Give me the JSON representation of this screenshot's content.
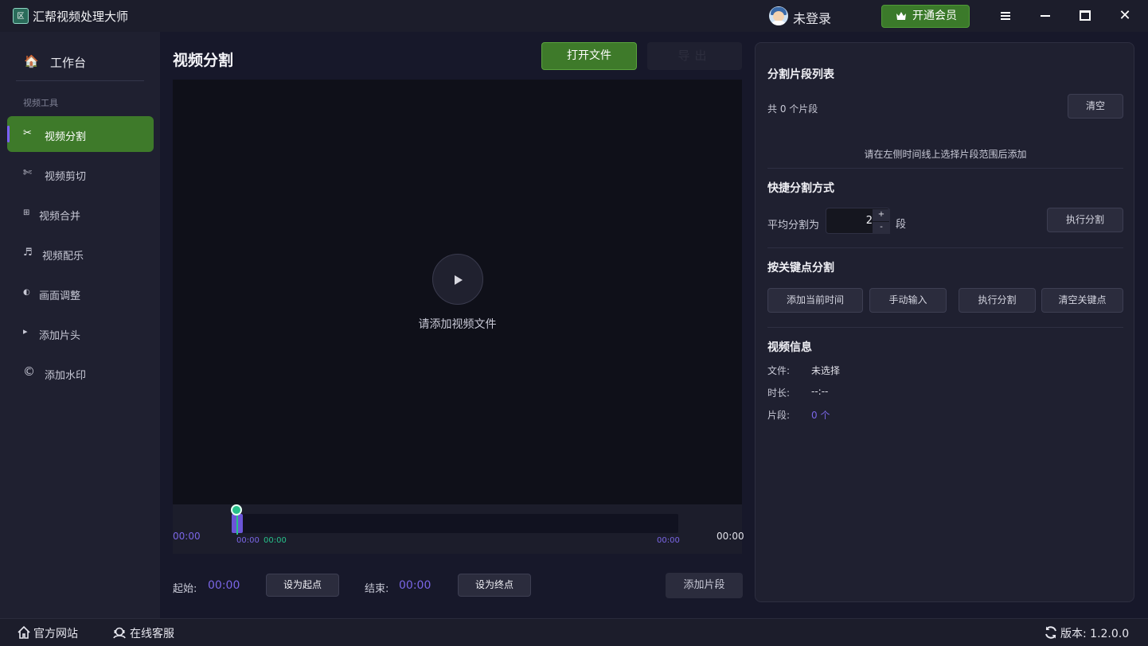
{
  "app": {
    "title": "汇帮视频处理大师",
    "logo_text": "区"
  },
  "titlebar": {
    "user_label": "未登录",
    "vip_button": "开通会员"
  },
  "sidebar": {
    "home": {
      "label": "工作台",
      "icon": "🏠"
    },
    "section_label": "视频工具",
    "items": [
      {
        "label": "视频分割",
        "icon": "✂"
      },
      {
        "label": "视频剪切",
        "icon": "✄"
      },
      {
        "label": "视频合并",
        "icon": "⊞"
      },
      {
        "label": "视频配乐",
        "icon": "♬"
      },
      {
        "label": "画面调整",
        "icon": "◐"
      },
      {
        "label": "添加片头",
        "icon": "▸"
      },
      {
        "label": "添加水印",
        "icon": "©"
      }
    ]
  },
  "main": {
    "title": "视频分割",
    "open_button": "打开文件",
    "export_button": "导出",
    "player_hint": "请添加视频文件",
    "timeline": {
      "time_left": "00:00",
      "time_right": "00:00",
      "marker_start": "00:00",
      "marker_current": "00:00",
      "marker_end": "00:00",
      "position_fraction": 0
    },
    "controls": {
      "start_label": "起始:",
      "start_value": "00:00",
      "set_start_button": "设为起点",
      "end_label": "结束:",
      "end_value": "00:00",
      "set_end_button": "设为终点",
      "add_segment_button": "添加片段"
    }
  },
  "panel": {
    "segments_title": "分割片段列表",
    "segments_count": "共 0 个片段",
    "clear_button": "清空",
    "segments_hint": "请在左侧时间线上选择片段范围后添加",
    "quick_title": "快捷分割方式",
    "average_label": "平均分割为",
    "average_value": "2",
    "spin_up": "+",
    "spin_down": "-",
    "segment_unit": "段",
    "execute_button": "执行分割",
    "keypoint_title": "按关键点分割",
    "add_current_button": "添加当前时间",
    "manual_input_button": "手动输入",
    "keypoint_execute_button": "执行分割",
    "clear_keypoints_button": "清空关键点",
    "info_title": "视频信息",
    "info_file_label": "文件:",
    "info_file_value": "未选择",
    "info_duration_label": "时长:",
    "info_duration_value": "--:--",
    "info_segments_label": "片段:",
    "info_segments_value": "0 个"
  },
  "statusbar": {
    "website": "官方网站",
    "support": "在线客服",
    "version": "版本: 1.2.0.0"
  },
  "colors": {
    "accent_green": "#3e7a2a",
    "accent_purple": "#7a66e6",
    "playhead": "#27c08a"
  }
}
